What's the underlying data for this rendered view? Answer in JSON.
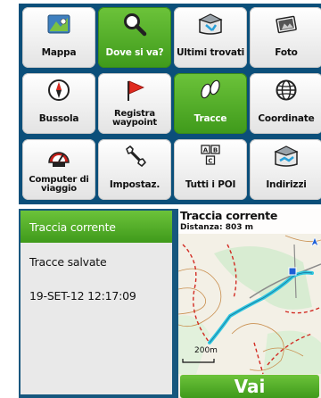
{
  "menu": {
    "items": [
      {
        "label": "Mappa",
        "icon": "map-icon"
      },
      {
        "label": "Dove si va?",
        "icon": "search-icon",
        "selected": true
      },
      {
        "label": "Ultimi trovati",
        "icon": "recent-finds-icon"
      },
      {
        "label": "Foto",
        "icon": "photo-icon"
      },
      {
        "label": "Bussola",
        "icon": "compass-icon"
      },
      {
        "label": "Registra waypoint",
        "icon": "flag-icon"
      },
      {
        "label": "Tracce",
        "icon": "footprints-icon",
        "selected": true
      },
      {
        "label": "Coordinate",
        "icon": "globe-icon"
      },
      {
        "label": "Computer di viaggio",
        "icon": "trip-computer-icon"
      },
      {
        "label": "Impostaz.",
        "icon": "wrench-icon"
      },
      {
        "label": "Tutti i POI",
        "icon": "poi-icon"
      },
      {
        "label": "Indirizzi",
        "icon": "address-icon"
      }
    ]
  },
  "tracks": {
    "items": [
      {
        "label": "Traccia corrente",
        "selected": true
      },
      {
        "label": "Tracce salvate"
      },
      {
        "label": "19-SET-12 12:17:09"
      }
    ]
  },
  "map": {
    "title": "Traccia corrente",
    "distance": "Distanza: 803 m",
    "scale": "200m",
    "go_label": "Vai"
  },
  "colors": {
    "accent_green": "#4fae27",
    "frame_blue": "#0b4f7a",
    "track_cyan": "#30c8e0"
  }
}
